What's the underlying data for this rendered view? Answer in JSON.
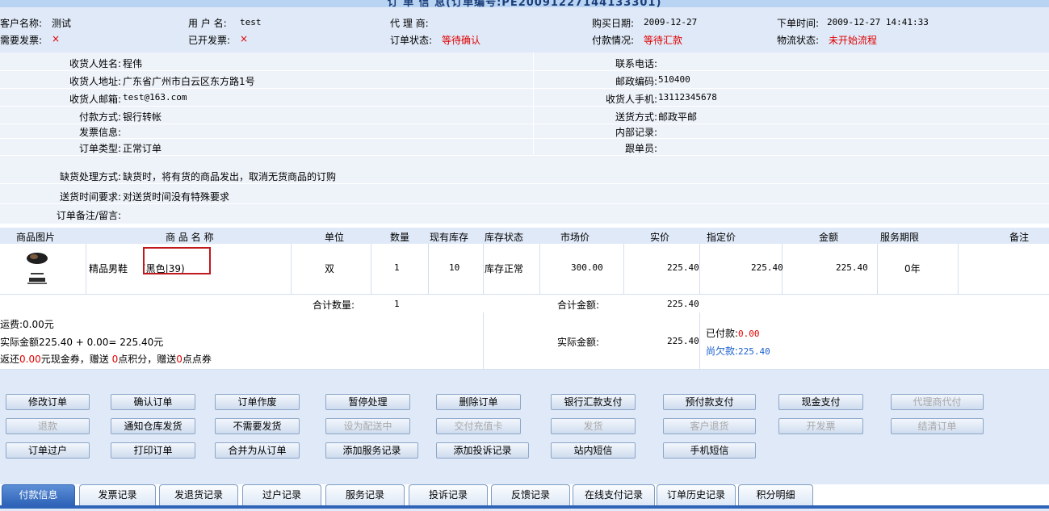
{
  "title": "订 单 信 息(订单编号:PE20091227144133301)",
  "header": {
    "customer_label": "客户名称:",
    "customer_value": "测试",
    "username_label": "用 户 名:",
    "username_value": "test",
    "agent_label": "代 理 商:",
    "agent_value": "",
    "buy_date_label": "购买日期:",
    "buy_date_value": "2009-12-27",
    "order_time_label": "下单时间:",
    "order_time_value": "2009-12-27 14:41:33",
    "need_invoice_label": "需要发票:",
    "need_invoice_value": "×",
    "invoiced_label": "已开发票:",
    "invoiced_value": "×",
    "order_status_label": "订单状态:",
    "order_status_value": "等待确认",
    "payment_label": "付款情况:",
    "payment_value": "等待汇款",
    "logistics_label": "物流状态:",
    "logistics_value": "未开始流程"
  },
  "details": {
    "rows": [
      {
        "label": "收货人姓名:",
        "value": "程伟",
        "label2": "联系电话:",
        "value2": ""
      },
      {
        "label": "收货人地址:",
        "value": "广东省广州市白云区东方路1号",
        "label2": "邮政编码:",
        "value2": "510400"
      },
      {
        "label": "收货人邮箱:",
        "value": "test@163.com",
        "label2": "收货人手机:",
        "value2": "13112345678"
      },
      {
        "label": "付款方式:",
        "value": "银行转帐",
        "label2": "送货方式:",
        "value2": "邮政平邮"
      },
      {
        "label": "发票信息:",
        "value": "",
        "label2": "内部记录:",
        "value2": ""
      },
      {
        "label": "订单类型:",
        "value": "正常订单",
        "label2": "跟单员:",
        "value2": ""
      },
      {
        "label": "缺货处理方式:",
        "value": "缺货时，将有货的商品发出，取消无货商品的订购"
      },
      {
        "label": "送货时间要求:",
        "value": "对送货时间没有特殊要求"
      },
      {
        "label": "订单备注/留言:",
        "value": ""
      }
    ]
  },
  "table": {
    "headers": [
      "商品图片",
      "商 品 名 称",
      "单位",
      "数量",
      "现有库存",
      "库存状态",
      "市场价",
      "实价",
      "指定价",
      "金额",
      "服务期限",
      "备注"
    ],
    "item": {
      "name": "精品男鞋",
      "spec": "(黑色|39)",
      "unit": "双",
      "qty": "1",
      "stock": "10",
      "stock_status": "库存正常",
      "market_price": "300.00",
      "real_price": "225.40",
      "set_price": "225.40",
      "amount": "225.40",
      "service": "0年",
      "note": ""
    },
    "total_qty_label": "合计数量:",
    "total_qty": "1",
    "total_amount_label": "合计金额:",
    "total_amount": "225.40"
  },
  "summary": {
    "freight": "运费:0.00元",
    "actual_formula": "实际金额225.40 + 0.00= 225.40元",
    "rebate_prefix": "返还",
    "rebate_amount": "0.00",
    "rebate_mid": "元现金券，赠送 ",
    "points": "0",
    "points_mid": "点积分，赠送",
    "dianquan": "0",
    "dianquan_suffix": "点点券",
    "actual_label": "实际金额:",
    "actual_value": "225.40",
    "paid_label": "已付款:",
    "paid_value": "0.00",
    "owed_label": "尚欠款:",
    "owed_value": "225.40"
  },
  "buttons": {
    "row1": [
      "修改订单",
      "确认订单",
      "订单作废",
      "暂停处理",
      "删除订单",
      "银行汇款支付",
      "预付款支付",
      "现金支付",
      "代理商代付"
    ],
    "row2": [
      "退款",
      "通知仓库发货",
      "不需要发货",
      "设为配送中",
      "交付充值卡",
      "发货",
      "客户退货",
      "开发票",
      "结清订单"
    ],
    "row3": [
      "订单过户",
      "打印订单",
      "合并为从订单",
      "添加服务记录",
      "添加投诉记录",
      "站内短信",
      "手机短信"
    ]
  },
  "tabs": [
    "付款信息",
    "发票记录",
    "发退货记录",
    "过户记录",
    "服务记录",
    "投诉记录",
    "反馈记录",
    "在线支付记录",
    "订单历史记录",
    "积分明细"
  ]
}
